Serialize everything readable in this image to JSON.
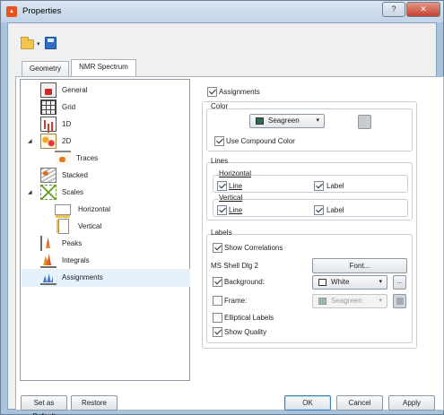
{
  "window": {
    "title": "Properties",
    "app_icon": "app-logo-icon"
  },
  "title_buttons": {
    "help": "?",
    "close": "✕"
  },
  "toolbar": {
    "open_icon": "folder-open-icon",
    "save_icon": "save-disk-icon",
    "dropdown_arrow": "▾"
  },
  "tabs": {
    "geometry": "Geometry",
    "nmr_spectrum": "NMR Spectrum"
  },
  "tree": {
    "expander": "◢",
    "items": [
      {
        "label": "General",
        "icon": "general-icon"
      },
      {
        "label": "Grid",
        "icon": "grid-icon"
      },
      {
        "label": "1D",
        "icon": "1d-icon"
      },
      {
        "label": "2D",
        "icon": "2d-icon"
      },
      {
        "label": "Traces",
        "icon": "traces-icon"
      },
      {
        "label": "Stacked",
        "icon": "stacked-icon"
      },
      {
        "label": "Scales",
        "icon": "scales-icon"
      },
      {
        "label": "Horizontal",
        "icon": "horizontal-scale-icon"
      },
      {
        "label": "Vertical",
        "icon": "vertical-scale-icon"
      },
      {
        "label": "Peaks",
        "icon": "peaks-icon"
      },
      {
        "label": "Integrals",
        "icon": "integrals-icon"
      },
      {
        "label": "Assignments",
        "icon": "assignments-icon",
        "selected": true
      }
    ]
  },
  "assignments": {
    "label": "Assignments",
    "checked": true,
    "color": {
      "title": "Color",
      "value": "Seagreen",
      "value_color": "#2e6b4f",
      "use_compound_color": "Use Compound Color",
      "use_compound_checked": true,
      "arrow": "▾"
    },
    "lines": {
      "title": "Lines",
      "horizontal": {
        "title": "Horizontal",
        "line": "Line",
        "label": "Label"
      },
      "vertical": {
        "title": "Vertical",
        "line": "Line",
        "label": "Label"
      }
    },
    "labels": {
      "title": "Labels",
      "show_correlations": "Show Correlations",
      "font_name": "MS Shell Dlg 2",
      "font_button": "Font...",
      "background": "Background:",
      "background_value": "White",
      "background_color": "#ffffff",
      "frame": "Frame:",
      "frame_value": "Seagreen",
      "frame_color": "#2e6b4f",
      "elliptical_labels": "Elliptical Labels",
      "show_quality": "Show Quality",
      "arrow": "▾",
      "more": "…"
    }
  },
  "footer": {
    "set_as_default": "Set as Default",
    "restore": "Restore",
    "ok": "OK",
    "cancel": "Cancel",
    "apply": "Apply"
  }
}
